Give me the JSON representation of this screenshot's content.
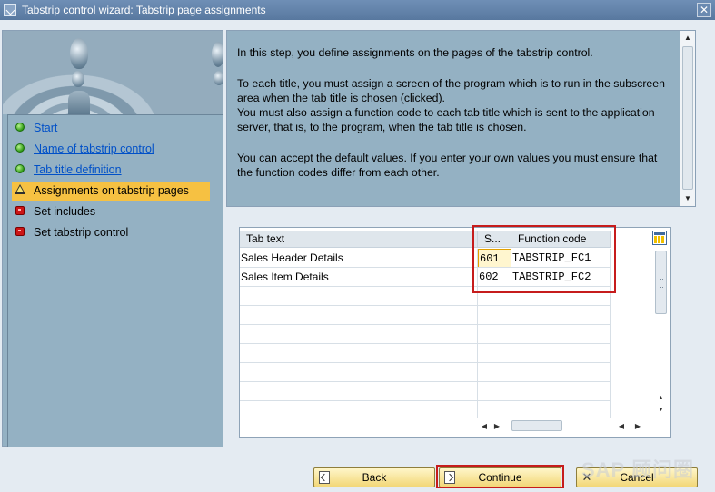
{
  "window": {
    "title": "Tabstrip control wizard: Tabstrip page assignments",
    "close_label": "✕"
  },
  "steps": [
    {
      "label": "Start",
      "status": "done",
      "icon": "green-light-icon"
    },
    {
      "label": "Name of tabstrip control",
      "status": "done",
      "icon": "green-light-icon"
    },
    {
      "label": "Tab title definition",
      "status": "done",
      "icon": "green-light-icon"
    },
    {
      "label": "Assignments on tabstrip pages",
      "status": "current",
      "icon": "warning-triangle-icon"
    },
    {
      "label": "Set includes",
      "status": "pending",
      "icon": "red-light-icon"
    },
    {
      "label": "Set tabstrip control",
      "status": "pending",
      "icon": "red-light-icon"
    }
  ],
  "info": {
    "p1": "In this step, you define assignments on the pages of the tabstrip control.",
    "p2a": "To each title, you must assign a screen of the program which is to run in the subscreen area when the tab title is chosen (clicked).",
    "p2b": "You must also assign a function code to each tab title which is sent to the application server, that is, to the program, when the tab title is chosen.",
    "p3": "You can accept the default values. If you enter your own values you must ensure that the function codes differ from each other."
  },
  "table": {
    "columns": [
      "Tab text",
      "S...",
      "Function code"
    ],
    "rows": [
      {
        "tab_text": "Sales Header Details",
        "screen": "601",
        "function_code": "TABSTRIP_FC1"
      },
      {
        "tab_text": "Sales Item Details",
        "screen": "602",
        "function_code": "TABSTRIP_FC2"
      }
    ],
    "empty_rows": 7
  },
  "buttons": {
    "back": "Back",
    "continue": "Continue",
    "cancel": "Cancel"
  },
  "watermark": "SAP 顾问圈",
  "colors": {
    "highlight": "#c61c1c",
    "current_step": "#f6c142",
    "link": "#0050c8"
  }
}
